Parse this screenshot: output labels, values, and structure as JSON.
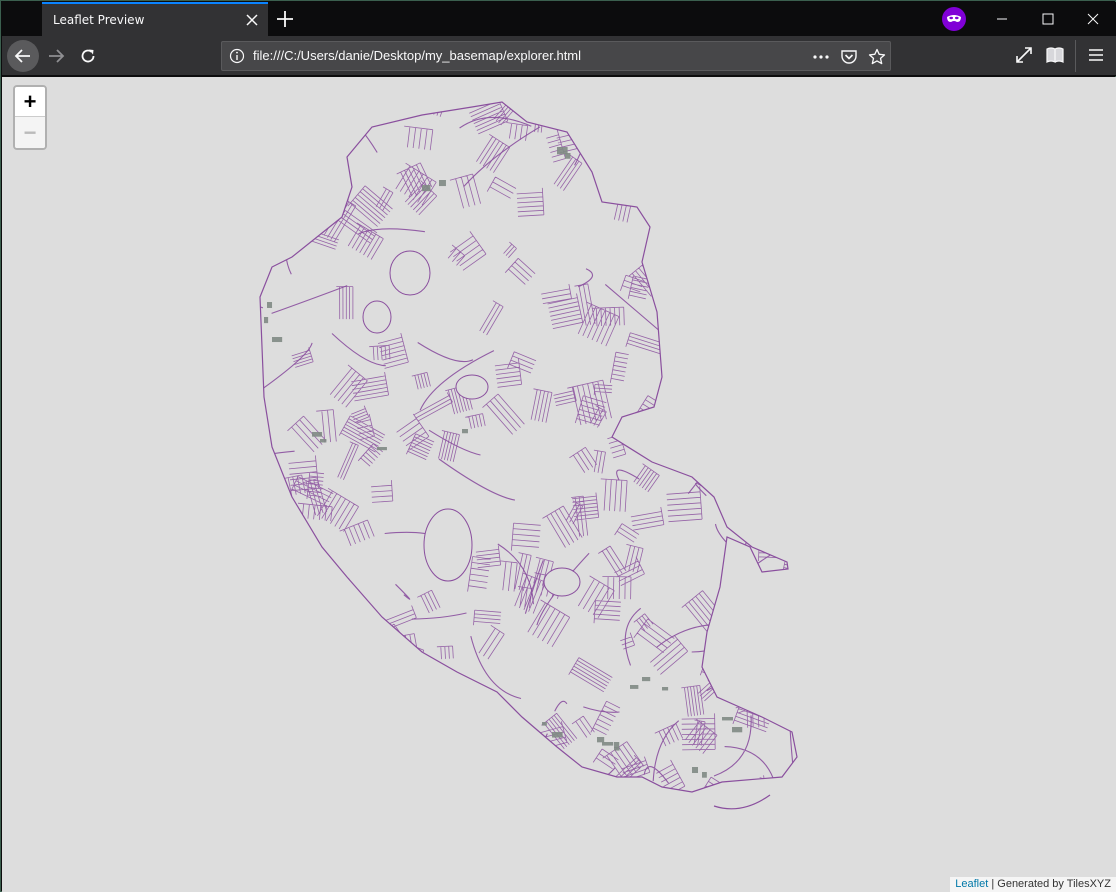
{
  "browser": {
    "tab_title": "Leaflet Preview",
    "url": "file:///C:/Users/danie/Desktop/my_basemap/explorer.html",
    "icons": {
      "close_tab": "close-icon",
      "new_tab": "plus-icon",
      "private": "private-browsing-mask-icon",
      "minimize": "minimize-icon",
      "maximize": "maximize-icon",
      "close_window": "close-icon",
      "back": "arrow-left-icon",
      "forward": "arrow-right-icon",
      "reload": "reload-icon",
      "info": "info-icon",
      "page_actions": "more-dots-icon",
      "pocket": "pocket-icon",
      "bookmark": "star-icon",
      "fullscreen": "expand-icon",
      "library": "library-icon",
      "menu": "hamburger-menu-icon"
    }
  },
  "map": {
    "zoom_in_label": "+",
    "zoom_out_label": "−",
    "attribution_link": "Leaflet",
    "attribution_text": " | Generated by TilesXYZ",
    "colors": {
      "background": "#dddddd",
      "roads": "#8a4f9e",
      "buildings": "#7f8a84"
    }
  }
}
